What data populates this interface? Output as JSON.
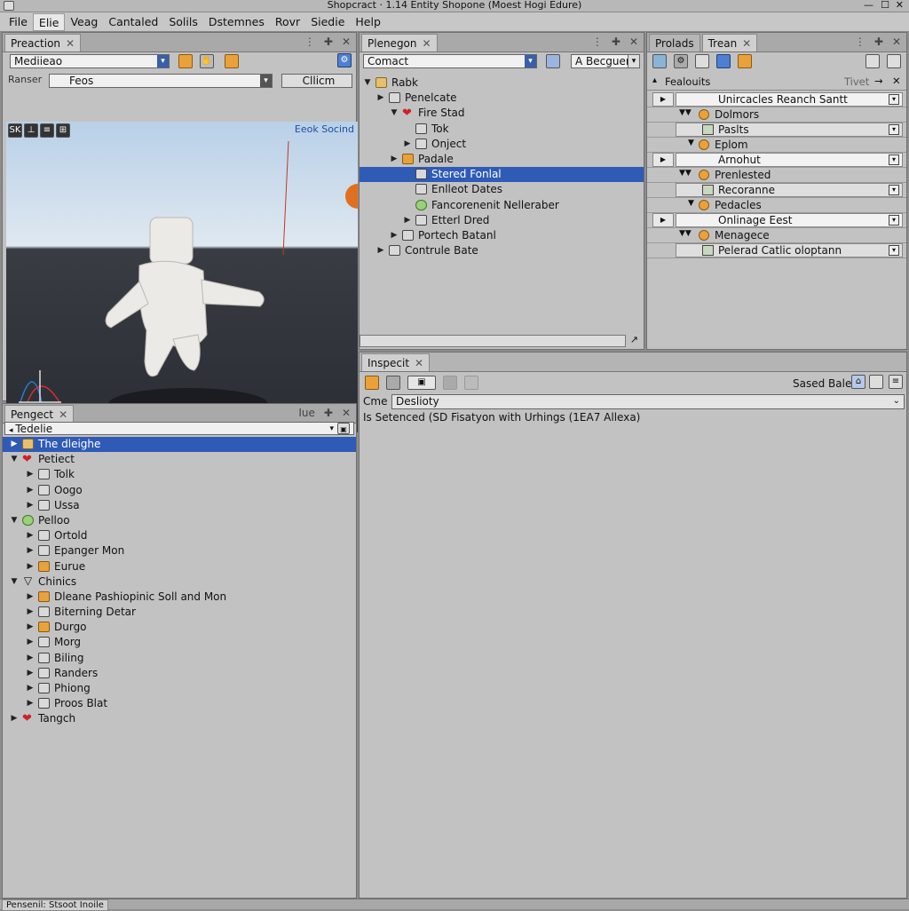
{
  "window": {
    "title": "Shopcract · 1.14 Entity Shopone (Moest Hogi Edure)"
  },
  "menu": [
    "File",
    "Elie",
    "Veag",
    "Cantaled",
    "Solils",
    "Dstemnes",
    "Rovr",
    "Siedie",
    "Help"
  ],
  "preaction": {
    "tab": "Preaction",
    "search_value": "Mediieao",
    "field2_label": "Ranser",
    "field2_value": "Feos",
    "button_label": "Cllicm",
    "scene_label": "Eeok Socind",
    "tool_icons": [
      "SK",
      "⊥",
      "≡",
      "⊞"
    ]
  },
  "pengect": {
    "tab": "Pengect",
    "tab_ctl": "Iue",
    "filter_value": "Tedelie",
    "items": [
      {
        "label": "The dleighe",
        "depth": 0,
        "arrow": "right",
        "selected": true,
        "icon": "folder"
      },
      {
        "label": "Petiect",
        "depth": 0,
        "arrow": "down",
        "icon": "heart"
      },
      {
        "label": "Tolk",
        "depth": 1,
        "arrow": "right",
        "icon": "box"
      },
      {
        "label": "Oogo",
        "depth": 1,
        "arrow": "right",
        "icon": "box"
      },
      {
        "label": "Ussa",
        "depth": 1,
        "arrow": "right",
        "icon": "box"
      },
      {
        "label": "Pelloo",
        "depth": 0,
        "arrow": "down",
        "icon": "leaf"
      },
      {
        "label": "Ortold",
        "depth": 1,
        "arrow": "right",
        "icon": "box"
      },
      {
        "label": "Epanger Mon",
        "depth": 1,
        "arrow": "right",
        "icon": "box"
      },
      {
        "label": "Eurue",
        "depth": 1,
        "arrow": "right",
        "icon": "orange"
      },
      {
        "label": "Chinics",
        "depth": 0,
        "arrow": "down",
        "icon": "filter"
      },
      {
        "label": "Dleane Pashiopinic Soll and Mon",
        "depth": 1,
        "arrow": "right",
        "icon": "orange"
      },
      {
        "label": "Biterning Detar",
        "depth": 1,
        "arrow": "right",
        "icon": "box"
      },
      {
        "label": "Durgo",
        "depth": 1,
        "arrow": "right",
        "icon": "orange"
      },
      {
        "label": "Morg",
        "depth": 1,
        "arrow": "right",
        "icon": "box"
      },
      {
        "label": "Biling",
        "depth": 1,
        "arrow": "right",
        "icon": "box"
      },
      {
        "label": "Randers",
        "depth": 1,
        "arrow": "right",
        "icon": "box"
      },
      {
        "label": "Phiong",
        "depth": 1,
        "arrow": "right",
        "icon": "box"
      },
      {
        "label": "Proos Blat",
        "depth": 1,
        "arrow": "right",
        "icon": "box"
      },
      {
        "label": "Tangch",
        "depth": 0,
        "arrow": "right",
        "icon": "heart"
      }
    ]
  },
  "plenegon": {
    "tab": "Plenegon",
    "search_value": "Comact",
    "select_value": "A Becguene",
    "items": [
      {
        "label": "Rabk",
        "depth": 0,
        "arrow": "down",
        "icon": "folder"
      },
      {
        "label": "Penelcate",
        "depth": 1,
        "arrow": "right",
        "icon": "box"
      },
      {
        "label": "Fire Stad",
        "depth": 2,
        "arrow": "down",
        "icon": "heart"
      },
      {
        "label": "Tok",
        "depth": 3,
        "arrow": "",
        "icon": "box"
      },
      {
        "label": "Onject",
        "depth": 3,
        "arrow": "right",
        "icon": "box"
      },
      {
        "label": "Padale",
        "depth": 2,
        "arrow": "right",
        "icon": "orange"
      },
      {
        "label": "Stered Fonlal",
        "depth": 3,
        "arrow": "",
        "icon": "box",
        "selected": true
      },
      {
        "label": "Enlleot Dates",
        "depth": 3,
        "arrow": "",
        "icon": "box"
      },
      {
        "label": "Fancorenenit Nelleraber",
        "depth": 3,
        "arrow": "",
        "icon": "leaf"
      },
      {
        "label": "Etterl Dred",
        "depth": 3,
        "arrow": "right",
        "icon": "box"
      },
      {
        "label": "Portech Batanl",
        "depth": 2,
        "arrow": "right",
        "icon": "box"
      },
      {
        "label": "Contrule Bate",
        "depth": 1,
        "arrow": "right",
        "icon": "box"
      }
    ]
  },
  "prolads": {
    "tab1": "Prolads",
    "tab2": "Trean",
    "header": "Fealouits",
    "header_right": "Tivet",
    "rows": [
      {
        "label": "Unircacles Reanch Santt",
        "arrow": "right",
        "icon": ""
      },
      {
        "label": "Dolmors",
        "arrow": "down2",
        "icon": "orange"
      },
      {
        "label": "Paslts",
        "arrow": "",
        "icon": "box"
      },
      {
        "label": "Eplom",
        "arrow": "down",
        "icon": "orange"
      },
      {
        "label": "Arnohut",
        "arrow": "right",
        "icon": ""
      },
      {
        "label": "Prenlested",
        "arrow": "down2",
        "icon": "orange"
      },
      {
        "label": "Recoranne",
        "arrow": "",
        "icon": "box"
      },
      {
        "label": "Pedacles",
        "arrow": "down",
        "icon": "orange"
      },
      {
        "label": "Onlinage Eest",
        "arrow": "right",
        "icon": ""
      },
      {
        "label": "Menagece",
        "arrow": "down2",
        "icon": "orange"
      },
      {
        "label": "Pelerad Catlic oloptann",
        "arrow": "",
        "icon": "box"
      }
    ]
  },
  "inspect": {
    "tab": "Inspecit",
    "right_label": "Sased Bale",
    "field_label": "Cme",
    "field_value": "Deslioty",
    "status_text": "Is Setenced (SD Fisatyon with Urhings (1EA7 Allexa)"
  },
  "footer": {
    "text": "Pensenil: Stsoot Inoile"
  },
  "colors": {
    "selection": "#2f5bb6",
    "panel": "#c2c2c2",
    "accent": "#3a5fa8"
  }
}
